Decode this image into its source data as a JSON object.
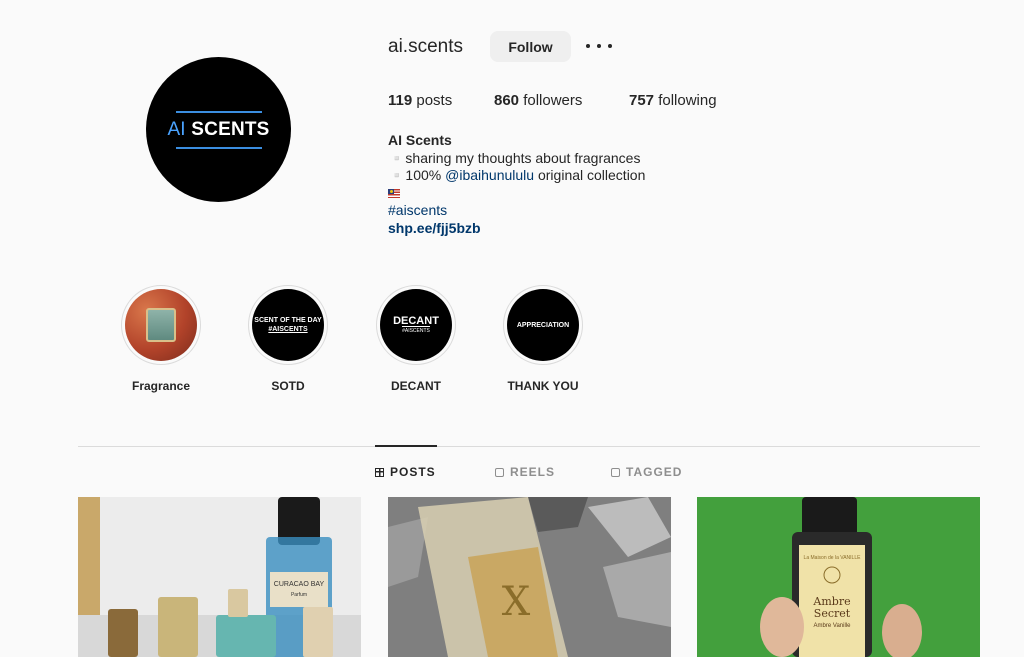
{
  "profile": {
    "username": "ai.scents",
    "follow_label": "Follow",
    "avatar_logo_prefix": "AI",
    "avatar_logo_suffix": " SCENTS",
    "stats": {
      "posts_count": "119",
      "posts_label": "posts",
      "followers_count": "860",
      "followers_label": "followers",
      "following_count": "757",
      "following_label": "following"
    },
    "bio": {
      "name": "AI Scents",
      "line1": "▫️sharing my thoughts about fragrances",
      "line2_prefix": "▫️100% ",
      "line2_mention": "@ibaihunululu",
      "line2_suffix": " original collection",
      "flag": "malaysia-flag",
      "hashtag": "#aiscents",
      "website": "shp.ee/fjj5bzb"
    }
  },
  "highlights": [
    {
      "label": "Fragrance",
      "cover": "photo"
    },
    {
      "label": "SOTD",
      "cover_line1": "SCENT OF THE DAY",
      "cover_line2": "#AISCENTS"
    },
    {
      "label": "DECANT",
      "cover_line1": "DECANT",
      "cover_line2": "#AISCENTS"
    },
    {
      "label": "THANK YOU",
      "cover_line1": "APPRECIATION"
    }
  ],
  "tabs": [
    {
      "label": "POSTS",
      "icon": "grid-icon",
      "active": true
    },
    {
      "label": "REELS",
      "icon": "reels-icon",
      "active": false
    },
    {
      "label": "TAGGED",
      "icon": "tagged-icon",
      "active": false
    }
  ],
  "posts": [
    {
      "bottle_label": "CURACAO BAY",
      "bottle_sublabel": "Parfum"
    },
    {
      "bottle_letter": "X"
    },
    {
      "bottle_label_line1": "Ambre",
      "bottle_label_line2": "Secret",
      "bottle_label_line3": "Ambre Vanille",
      "brand_text": "La Maison de la VANILLE"
    }
  ],
  "colors": {
    "background": "#fafafa",
    "link": "#00376b",
    "button_bg": "#efefef",
    "accent_blue": "#4aa3ff"
  }
}
